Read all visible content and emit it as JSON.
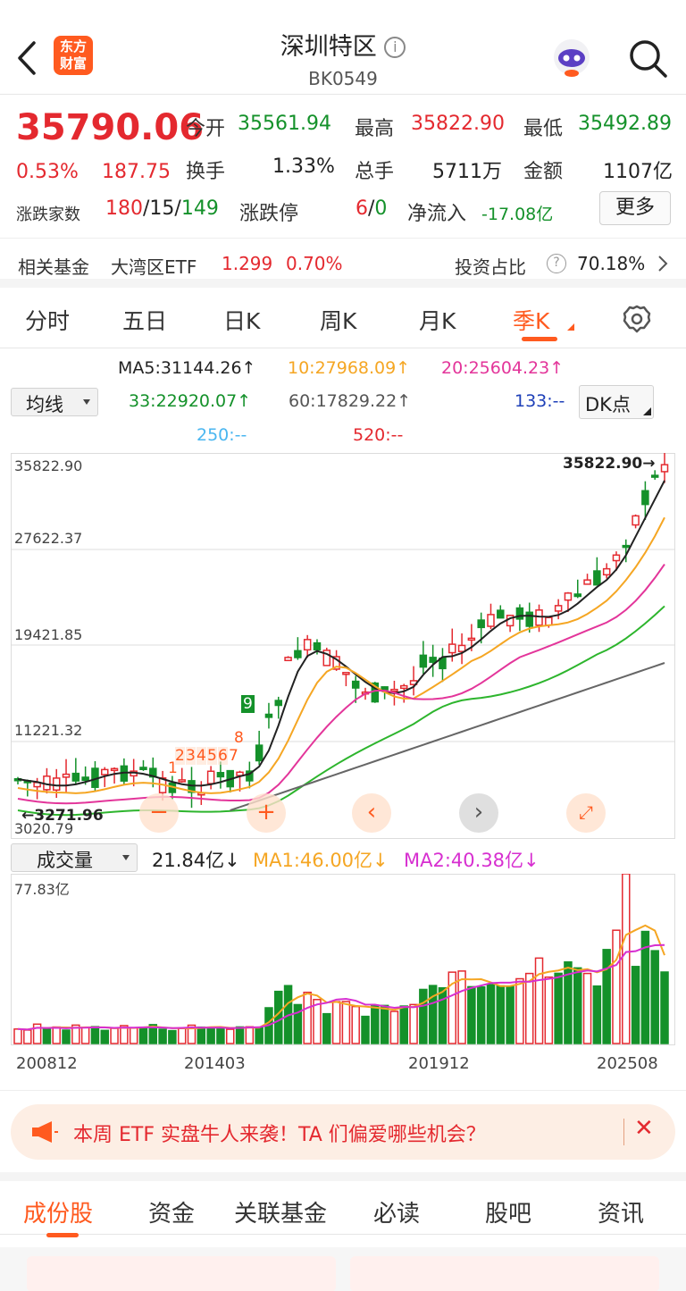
{
  "header": {
    "title": "深圳特区",
    "code": "BK0549",
    "logo_line1": "东方",
    "logo_line2": "财富"
  },
  "quote": {
    "price": "35790.06",
    "change_pct": "0.53%",
    "change": "187.75",
    "open_label": "今开",
    "open": "35561.94",
    "high_label": "最高",
    "high": "35822.90",
    "low_label": "最低",
    "low": "35492.89",
    "turnover_label": "换手",
    "turnover": "1.33%",
    "volume_label": "总手",
    "volume": "5711万",
    "amount_label": "金额",
    "amount": "1107亿",
    "breadth_label": "涨跌家数",
    "up": "180",
    "flat": "15",
    "down": "149",
    "slash": "/",
    "limit_label": "涨跌停",
    "limit_up": "6",
    "limit_down": "0",
    "inflow_label": "净流入",
    "inflow": "-17.08亿",
    "more": "更多"
  },
  "fund": {
    "label": "相关基金",
    "name": "大湾区ETF",
    "price": "1.299",
    "pct": "0.70%",
    "ratio_label": "投资占比",
    "ratio": "70.18%"
  },
  "tabs": [
    "分时",
    "五日",
    "日K",
    "周K",
    "月K",
    "季K"
  ],
  "ma_legend": {
    "ma5": "MA5:31144.26↑",
    "ma10": "10:27968.09↑",
    "ma20": "20:25604.23↑",
    "ma33": "33:22920.07↑",
    "ma60": "60:17829.22↑",
    "ma133": "133:--",
    "ma250": "250:--",
    "ma520": "520:--",
    "avg_select": "均线",
    "dk_select": "DK点"
  },
  "kchart": {
    "y_labels": [
      "35822.90",
      "27622.37",
      "19421.85",
      "11221.32",
      "3020.79"
    ],
    "max_label": "35822.90→",
    "min_label": "3271.96",
    "min_prefix": "←",
    "counts": [
      "1",
      "2",
      "3",
      "4",
      "5",
      "6",
      "7",
      "8",
      "9"
    ]
  },
  "volume": {
    "select": "成交量",
    "value": "21.84亿↓",
    "ma1": "MA1:46.00亿↓",
    "ma2": "MA2:40.38亿↓",
    "max_label": "77.83亿"
  },
  "x_labels": [
    "200812",
    "201403",
    "201912",
    "202508"
  ],
  "banner": {
    "text": "本周 ETF 实盘牛人来袭！TA 们偏爱哪些机会？",
    "close": "✕"
  },
  "bottom_tabs": [
    "成份股",
    "资金",
    "关联基金",
    "必读",
    "股吧",
    "资讯"
  ],
  "colors": {
    "accent": "#ff5a1f",
    "up": "#e4292f",
    "down": "#14912a"
  }
}
